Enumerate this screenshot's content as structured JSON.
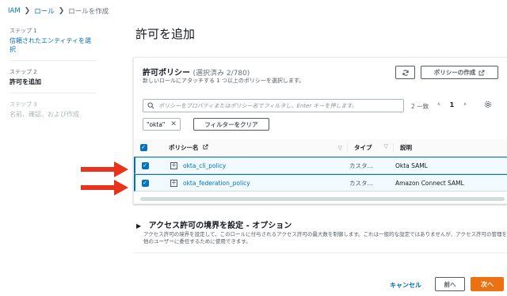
{
  "breadcrumb": {
    "items": [
      "IAM",
      "ロール",
      "ロールを作成"
    ]
  },
  "steps": [
    {
      "num": "ステップ 1",
      "title": "信頼されたエンティティを選択"
    },
    {
      "num": "ステップ 2",
      "title": "許可を追加"
    },
    {
      "num": "ステップ 3",
      "title": "名前、確認、および作成"
    }
  ],
  "page_title": "許可を追加",
  "policies_panel": {
    "title": "許可ポリシー",
    "selected_count": "(選択済み 2/780)",
    "description": "新しいロールにアタッチする 1 つ以上のポリシーを選択します。",
    "create_button": "ポリシーの作成",
    "search_placeholder": "ポリシーをプロパティまたはポリシー名でフィルタし、Enter キーを押します。",
    "match_count": "2 一致",
    "page_number": "1",
    "filter_token": "\"okta\"",
    "clear_filter_button": "フィルターをクリア"
  },
  "table": {
    "headers": {
      "name": "ポリシー名",
      "type": "タイプ",
      "description": "説明"
    },
    "rows": [
      {
        "name": "okta_cli_policy",
        "type": "カスタ...",
        "description": "Okta SAML"
      },
      {
        "name": "okta_federation_policy",
        "type": "カスタ...",
        "description": "Amazon Connect SAML"
      }
    ]
  },
  "boundary": {
    "title": "アクセス許可の境界を設定 - オプション",
    "description": "アクセス許可の境界を設定して、このロールに付与されるアクセス許可の最大数を制御します。これは一般的な設定ではありませんが、アクセス許可の管理を他のユーザーに委任するために使用できます。"
  },
  "footer": {
    "cancel": "キャンセル",
    "previous": "前へ",
    "next": "次へ"
  },
  "colors": {
    "link": "#0073bb",
    "primary": "#ec7211",
    "arrow": "#e8341c"
  },
  "icons": {
    "refresh": "refresh-icon",
    "external": "external-link-icon",
    "search": "search-icon",
    "settings": "gear-icon"
  }
}
